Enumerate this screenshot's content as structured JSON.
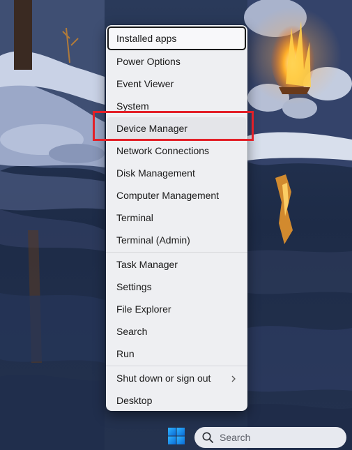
{
  "menu": {
    "items": [
      {
        "label": "Installed apps"
      },
      {
        "label": "Power Options"
      },
      {
        "label": "Event Viewer"
      },
      {
        "label": "System"
      },
      {
        "label": "Device Manager"
      },
      {
        "label": "Network Connections"
      },
      {
        "label": "Disk Management"
      },
      {
        "label": "Computer Management"
      },
      {
        "label": "Terminal"
      },
      {
        "label": "Terminal (Admin)"
      },
      {
        "label": "Task Manager"
      },
      {
        "label": "Settings"
      },
      {
        "label": "File Explorer"
      },
      {
        "label": "Search"
      },
      {
        "label": "Run"
      },
      {
        "label": "Shut down or sign out",
        "icon": "chevron-right-icon"
      },
      {
        "label": "Desktop"
      }
    ]
  },
  "taskbar": {
    "start_icon": "windows-logo-icon",
    "search_placeholder": "Search",
    "search_icon": "search-icon"
  },
  "colors": {
    "highlight_box": "#e32028",
    "menu_bg": "#eeeff2",
    "windows_blue": "#0078d4"
  }
}
